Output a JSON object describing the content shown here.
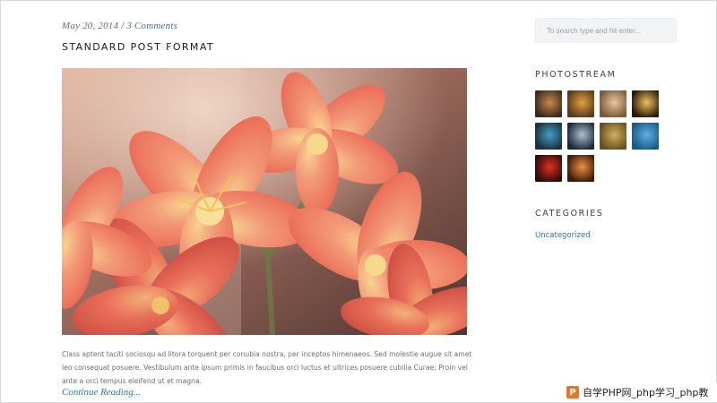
{
  "post": {
    "date": "May 20, 2014",
    "separator": "/",
    "comments": "3 Comments",
    "title": "STANDARD POST FORMAT",
    "image_alt": "Coral clivia flowers",
    "excerpt": "Class aptent taciti sociosqu ad litora torquent per conubia nostra, per inceptos himenaeos. Sed molestie augue sit amet leo consequat posuere. Vestibulum ante ipsum primis in faucibus orci luctus et ultrices posuere cubilia Curae; Proin vel ante a orci tempus eleifend ut et magna.",
    "continue_label": "Continue Reading..."
  },
  "sidebar": {
    "search_placeholder": "To search type and hit enter...",
    "photostream_title": "PHOTOSTREAM",
    "photos": [
      {
        "name": "photo-pen",
        "colors": [
          "#3a2a20",
          "#c88a4a"
        ]
      },
      {
        "name": "photo-steps",
        "colors": [
          "#5a3a1a",
          "#e0a040"
        ]
      },
      {
        "name": "photo-street",
        "colors": [
          "#7a5a3a",
          "#e8c8a0"
        ]
      },
      {
        "name": "photo-tunnel-light",
        "colors": [
          "#2a1a0a",
          "#f0c060"
        ]
      },
      {
        "name": "photo-city-night",
        "colors": [
          "#1a3040",
          "#40a0c0"
        ]
      },
      {
        "name": "photo-portrait",
        "colors": [
          "#1a2a3a",
          "#b0c0d0"
        ]
      },
      {
        "name": "photo-building",
        "colors": [
          "#6a5020",
          "#d0b060"
        ]
      },
      {
        "name": "photo-waves",
        "colors": [
          "#1a5a8a",
          "#60b0e0"
        ]
      },
      {
        "name": "photo-red-lights",
        "colors": [
          "#300a0a",
          "#e03020"
        ]
      },
      {
        "name": "photo-sunset",
        "colors": [
          "#3a1a0a",
          "#f09040"
        ]
      }
    ],
    "categories_title": "CATEGORIES",
    "categories": [
      "Uncategorized"
    ]
  },
  "watermark": {
    "icon_letter": "P",
    "text": "自学PHP网_php学习_php教"
  },
  "colors": {
    "link": "#3b6fa8",
    "search_bg": "#f2f3f4",
    "heading": "#1a1a1a"
  }
}
